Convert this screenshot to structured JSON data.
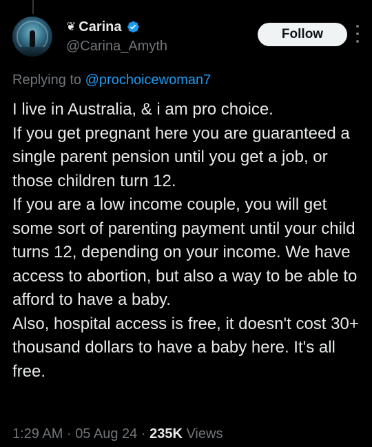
{
  "author": {
    "emoji_prefix": "❦",
    "display_name": "Carina",
    "verified": true,
    "handle": "@Carina_Amyth"
  },
  "follow_label": "Follow",
  "reply": {
    "prefix": "Replying to",
    "to_handle": "@prochoicewoman7"
  },
  "tweet": {
    "text": "I live in Australia, & i am pro choice.\nIf you get pregnant here you are guaranteed a single parent pension until you get a job, or those children turn 12.\nIf you are a low income couple, you will get some sort of parenting payment until your child turns 12, depending on your income. We have access to abortion, but also a way to be able to afford to have a baby.\nAlso, hospital access is free, it doesn't cost 30+ thousand dollars to have a baby here. It's all free."
  },
  "meta": {
    "time": "1:29 AM",
    "date": "05 Aug 24",
    "separator": "·",
    "views_count": "235K",
    "views_label": "Views"
  },
  "colors": {
    "background": "#000000",
    "text": "#e7e9ea",
    "muted": "#71767b",
    "link": "#1d9bf0",
    "follow_bg": "#eff3f4"
  }
}
